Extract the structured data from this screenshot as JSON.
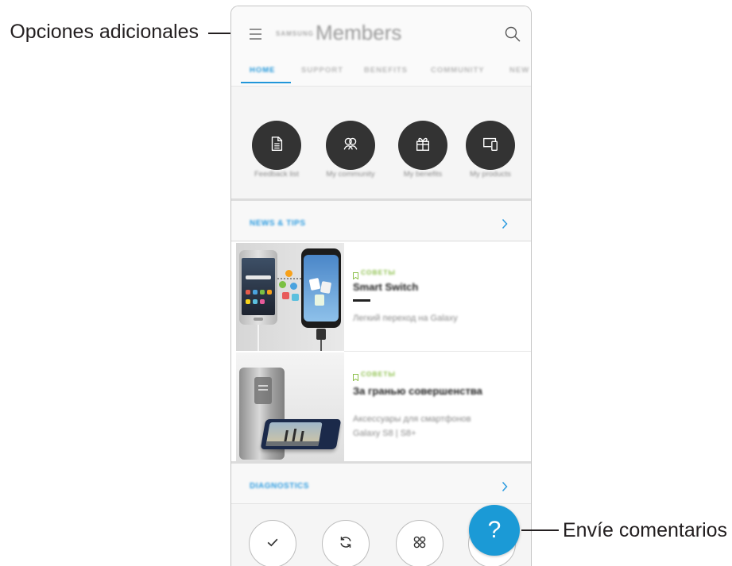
{
  "callouts": {
    "left": "Opciones adicionales",
    "right": "Envíe comentarios"
  },
  "header": {
    "brand": "SAMSUNG",
    "title": "Members",
    "menu_icon": "hamburger-icon",
    "search_icon": "search-icon"
  },
  "tabs": [
    {
      "label": "HOME",
      "active": true
    },
    {
      "label": "SUPPORT",
      "active": false
    },
    {
      "label": "BENEFITS",
      "active": false
    },
    {
      "label": "COMMUNITY",
      "active": false
    },
    {
      "label": "NEW",
      "active": false
    }
  ],
  "quick_links": [
    {
      "label": "Feedback list",
      "icon": "document-icon"
    },
    {
      "label": "My community",
      "icon": "community-icon"
    },
    {
      "label": "My benefits",
      "icon": "gift-icon"
    },
    {
      "label": "My products",
      "icon": "devices-icon"
    }
  ],
  "sections": {
    "news": {
      "title": "NEWS & TIPS",
      "icon": "chevron-right-icon"
    },
    "diagnostics": {
      "title": "DIAGNOSTICS",
      "icon": "chevron-right-icon"
    }
  },
  "cards": [
    {
      "tag": "СОВЕТЫ",
      "title": "Smart Switch",
      "subtitle_1": "Легкий переход на Galaxy",
      "image": "smart-switch-phones-image"
    },
    {
      "tag": "СОВЕТЫ",
      "title": "За гранью совершенства",
      "subtitle_1": "Аксессуары для смартфонов",
      "subtitle_2": "Galaxy S8 | S8+",
      "image": "clear-view-cover-image"
    }
  ],
  "bottom_actions": [
    {
      "icon": "check-icon"
    },
    {
      "icon": "sync-icon"
    },
    {
      "icon": "apps-icon"
    },
    {
      "icon": "hidden-button"
    }
  ],
  "fab": {
    "label": "?",
    "icon": "help-icon"
  },
  "colors": {
    "accent": "#2196d9",
    "fab": "#1b9ad6",
    "circle_bg": "#333333",
    "tag": "#8cbf4a",
    "callout_text": "#231f20"
  }
}
